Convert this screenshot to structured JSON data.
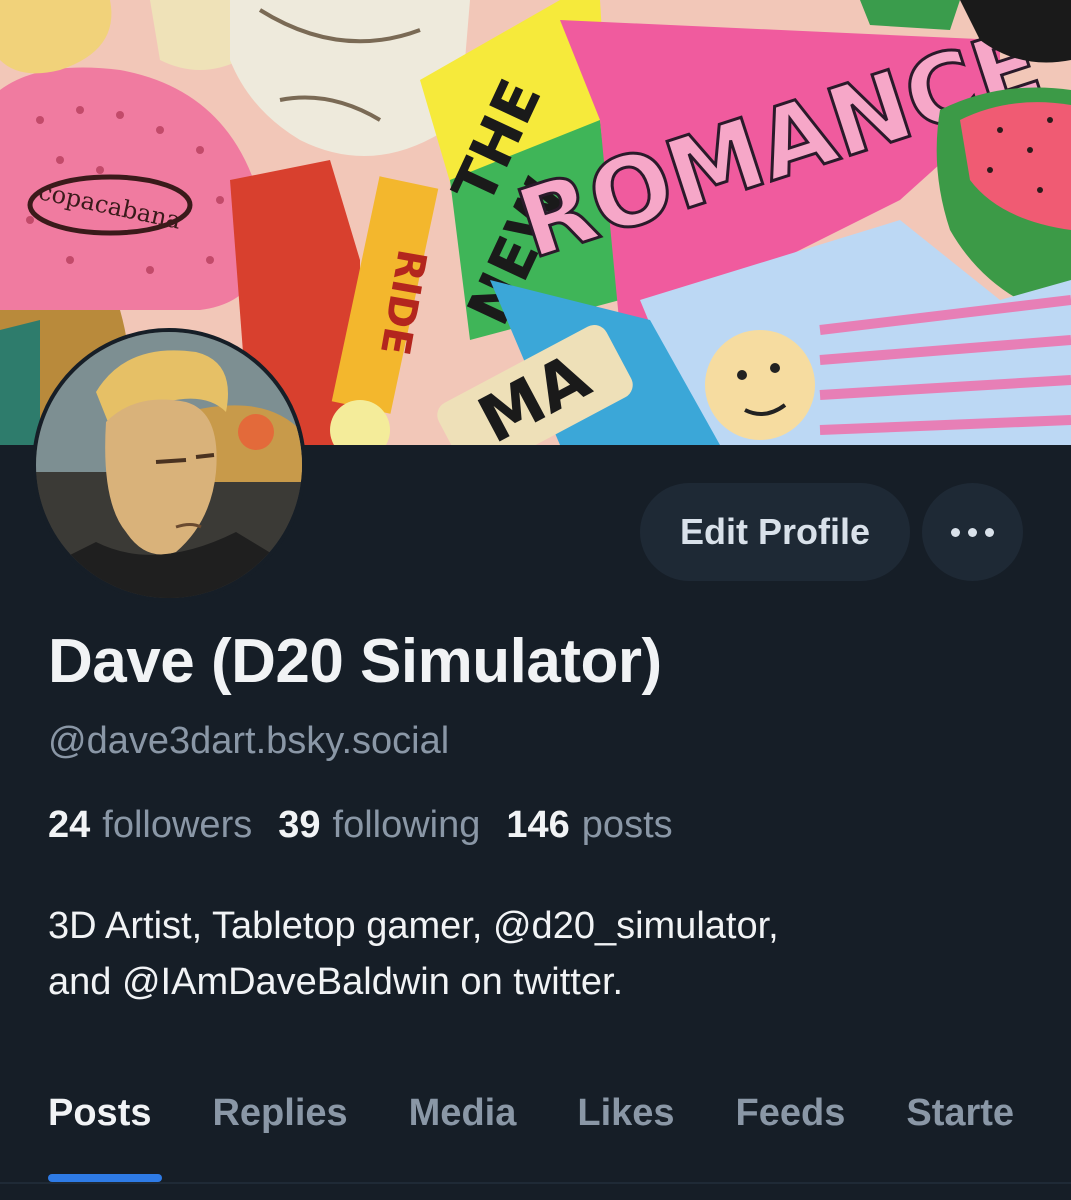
{
  "profile": {
    "display_name": "Dave (D20 Simulator)",
    "handle": "@dave3dart.bsky.social",
    "bio_line1": "3D Artist, Tabletop gamer, @d20_simulator,",
    "bio_line2": "and @IAmDaveBaldwin on twitter."
  },
  "stats": {
    "followers_count": "24",
    "followers_label": "followers",
    "following_count": "39",
    "following_label": "following",
    "posts_count": "146",
    "posts_label": "posts"
  },
  "actions": {
    "edit_label": "Edit Profile",
    "more_icon": "ellipsis-icon"
  },
  "tabs": [
    {
      "label": "Posts",
      "active": true
    },
    {
      "label": "Replies",
      "active": false
    },
    {
      "label": "Media",
      "active": false
    },
    {
      "label": "Likes",
      "active": false
    },
    {
      "label": "Feeds",
      "active": false
    },
    {
      "label": "Starte",
      "active": false
    }
  ],
  "banner": {
    "text_the": "THE",
    "text_new": "NEW",
    "text_romance": "ROMANCE",
    "text_brand": "copacabana",
    "text_ride": "RIDE",
    "text_ma": "MA"
  },
  "colors": {
    "background": "#161e27",
    "button_bg": "#1e2935",
    "text_primary": "#f1f3f5",
    "text_secondary": "#8a97a6",
    "accent": "#2e7be6"
  }
}
